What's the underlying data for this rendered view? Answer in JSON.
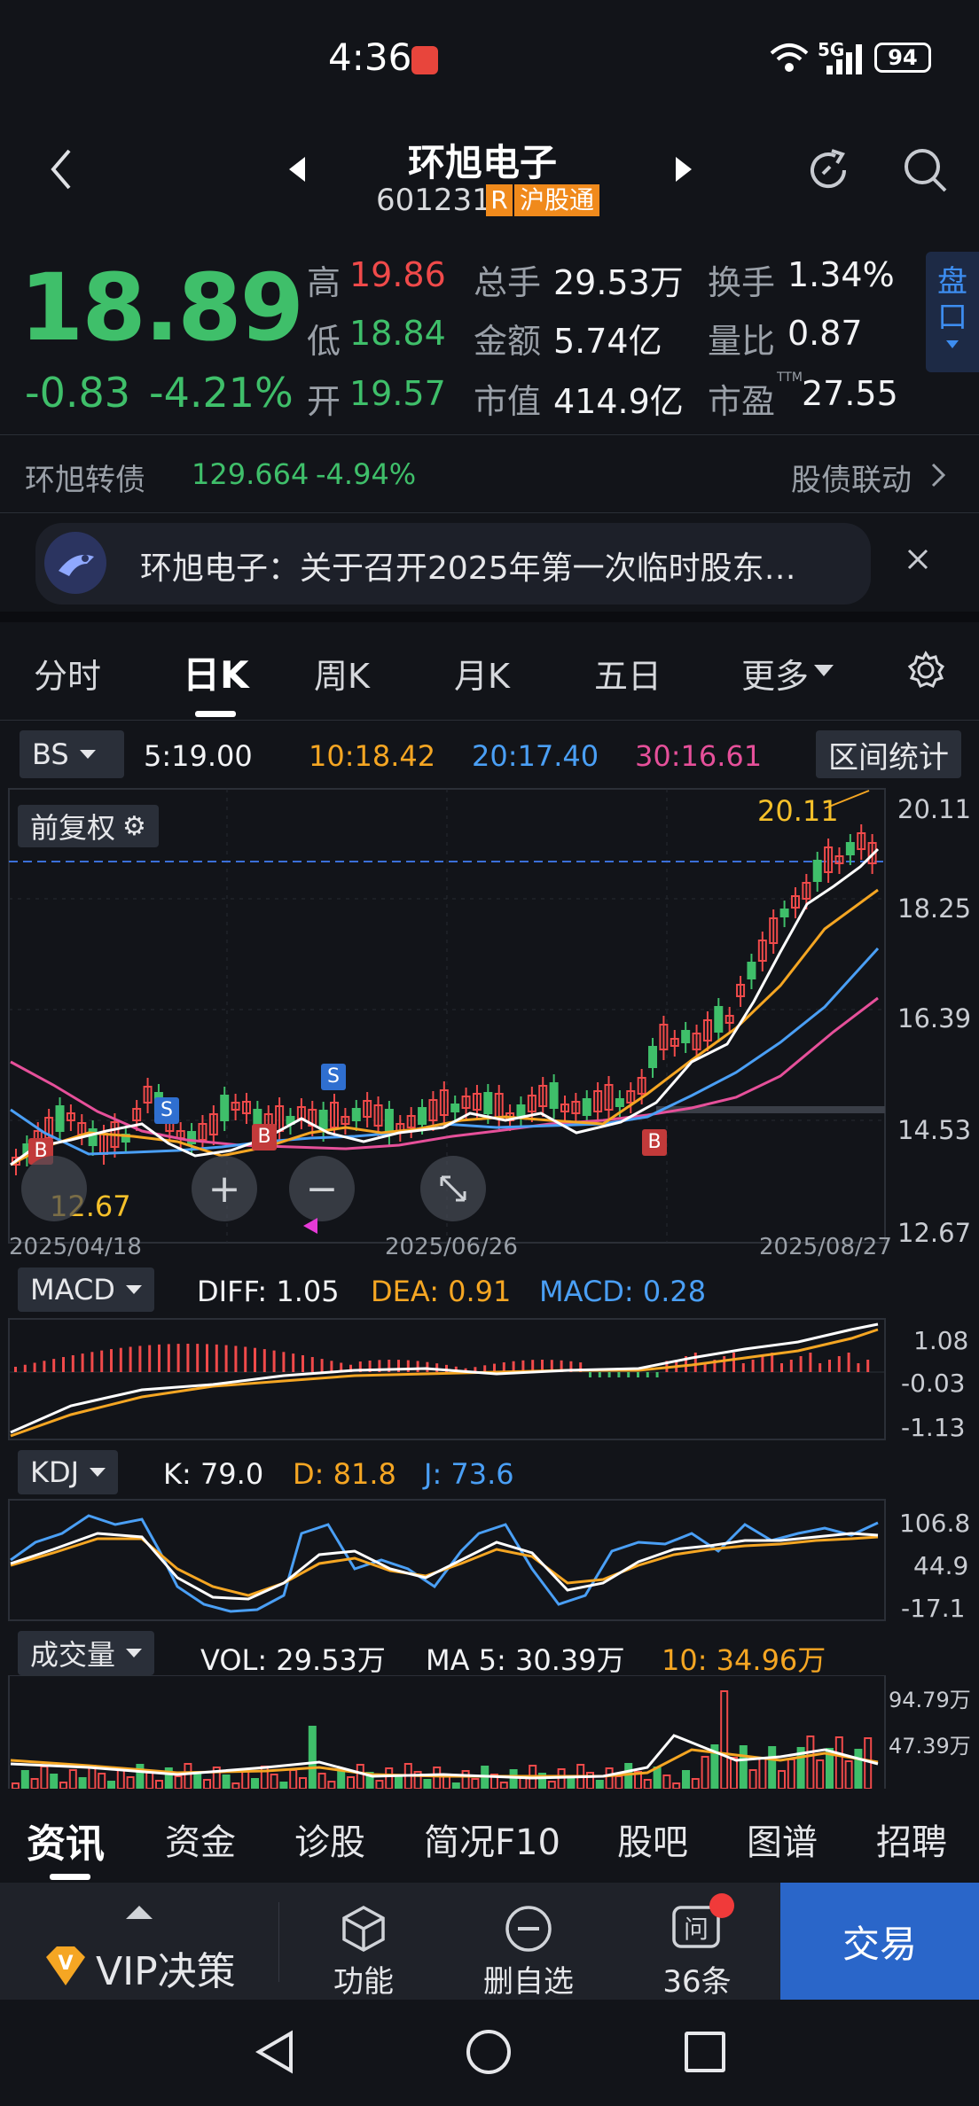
{
  "status_bar": {
    "time": "4:36",
    "network": "5G",
    "battery": "94"
  },
  "header": {
    "title": "环旭电子",
    "code": "601231",
    "badge_r": "R",
    "badge_connect": "沪股通"
  },
  "quote": {
    "price": "18.89",
    "change": "-0.83",
    "change_pct": "-4.21%",
    "high_label": "高",
    "high": "19.86",
    "low_label": "低",
    "low": "18.84",
    "open_label": "开",
    "open": "19.57",
    "volume_label": "总手",
    "volume": "29.53万",
    "amount_label": "金额",
    "amount": "5.74亿",
    "mcap_label": "市值",
    "mcap": "414.9亿",
    "turnover_label": "换手",
    "turnover": "1.34%",
    "vol_ratio_label": "量比",
    "vol_ratio": "0.87",
    "pe_label": "市盈",
    "pe_sup": "TTM",
    "pe": "27.55",
    "side_button": "盘口"
  },
  "bond": {
    "name": "环旭转债",
    "price": "129.664",
    "change": "-4.94%",
    "link": "股债联动"
  },
  "notice": {
    "text": "环旭电子：关于召开2025年第一次临时股东…"
  },
  "tabs": [
    "分时",
    "日K",
    "周K",
    "月K",
    "五日",
    "更多"
  ],
  "ma_bar": {
    "bs": "BS",
    "ma5": "5:19.00",
    "ma10": "10:18.42",
    "ma20": "20:17.40",
    "ma30": "30:16.61",
    "range_button": "区间统计"
  },
  "kline": {
    "adjust_label": "前复权",
    "max_label": "20.11",
    "min_label": "12.67",
    "y_ticks": [
      "20.11",
      "18.25",
      "16.39",
      "14.53",
      "12.67"
    ],
    "dates": [
      "2025/04/18",
      "2025/06/26",
      "2025/08/27"
    ],
    "markers": [
      "B",
      "S",
      "B",
      "S",
      "B"
    ]
  },
  "macd": {
    "label": "MACD",
    "diff": "DIFF: 1.05",
    "dea": "DEA: 0.91",
    "macd": "MACD: 0.28",
    "ticks": [
      "1.08",
      "-0.03",
      "-1.13"
    ]
  },
  "kdj": {
    "label": "KDJ",
    "k": "K: 79.0",
    "d": "D: 81.8",
    "j": "J: 73.6",
    "ticks": [
      "106.8",
      "44.9",
      "-17.1"
    ]
  },
  "volume_panel": {
    "label": "成交量",
    "vol": "VOL: 29.53万",
    "ma5": "MA 5: 30.39万",
    "ma10": "10: 34.96万",
    "ticks": [
      "94.79万",
      "47.39万"
    ]
  },
  "bottom_tabs": [
    "资讯",
    "资金",
    "诊股",
    "简况F10",
    "股吧",
    "图谱",
    "招聘"
  ],
  "bottom_nav": {
    "vip": "VIP决策",
    "func": "功能",
    "remove": "删自选",
    "ask": "36条",
    "trade": "交易"
  },
  "colors": {
    "up": "#f04a4a",
    "down": "#3fbf6a",
    "ma5": "#ffffff",
    "ma10": "#f5a623",
    "ma20": "#4a9ff5",
    "ma30": "#e6509a",
    "trade": "#2a66c9"
  }
}
